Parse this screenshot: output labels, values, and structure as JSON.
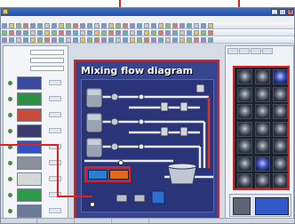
{
  "window": {
    "title": "",
    "buttons": [
      "_",
      "□",
      "×"
    ]
  },
  "menubar": {
    "items": [
      "",
      "",
      "",
      "",
      "",
      "",
      "",
      "",
      ""
    ]
  },
  "canvas": {
    "title": "Mixing flow diagram"
  },
  "left_panel": {
    "properties": [
      {
        "label": "",
        "value": ""
      },
      {
        "label": "",
        "value": ""
      },
      {
        "label": "",
        "value": ""
      }
    ],
    "thumbnails": [
      {
        "color": "#3a4aa0"
      },
      {
        "color": "#2f8f44"
      },
      {
        "color": "#c84a3a"
      },
      {
        "color": "#3b3b6e"
      },
      {
        "color": "#2b54c9"
      },
      {
        "color": "#8a8f9a"
      },
      {
        "color": "#d7d7d7"
      },
      {
        "color": "#2f9b4a"
      },
      {
        "color": "#6b7a99"
      }
    ]
  },
  "hmi_buttons": [
    {
      "label": "",
      "color": "#2b7fd0"
    },
    {
      "label": "",
      "color": "#e06a1a"
    }
  ],
  "colors": {
    "accent_red": "#e0211c",
    "canvas_blue": "#36458e",
    "pipe_white": "#e8ebf3",
    "pipe_red": "#d7342f"
  },
  "icons": {
    "tank": "tank-icon",
    "valve": "valve-icon",
    "mixer": "mixer-icon",
    "gauge": "gauge-icon"
  }
}
